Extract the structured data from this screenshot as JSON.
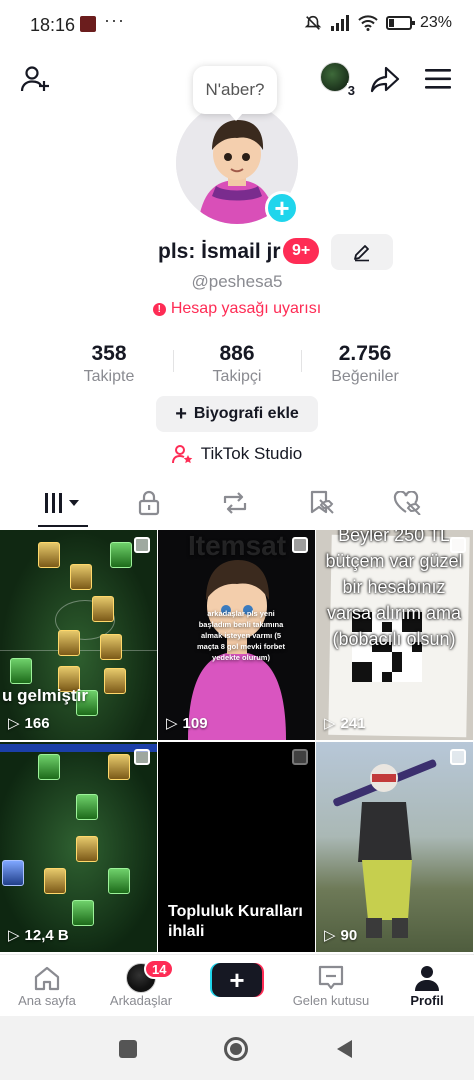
{
  "status_bar": {
    "time": "18:16",
    "dots": "···",
    "battery": "23%"
  },
  "header": {
    "friends_count": "3"
  },
  "tooltip": "N'aber?",
  "profile": {
    "username": "pls: İsmail jr",
    "badge": "9+",
    "handle": "@peshesa5",
    "warning": "Hesap yasağı uyarısı"
  },
  "stats": [
    {
      "value": "358",
      "label": "Takipte"
    },
    {
      "value": "886",
      "label": "Takipçi"
    },
    {
      "value": "2.756",
      "label": "Beğeniler"
    }
  ],
  "bio_button": "Biyografi ekle",
  "studio_link": "TikTok Studio",
  "tabs": [
    "videos-tab",
    "private-tab",
    "reposts-tab",
    "favorites-tab",
    "liked-tab"
  ],
  "videos": [
    {
      "views": "166",
      "overlay": "u gelmiştir"
    },
    {
      "views": "109",
      "overlay": "arkadaşlar pls yeni başladım benli takımına almak isteyen varmı (5 maçta 8 gol mevki forbet yedekte olurum)",
      "watermark": "Itemsat"
    },
    {
      "views": "241",
      "overlay": "Beyler 250 TL bütçem var güzel bir hesabınız varsa alırım ama (bobacılı olsun)"
    },
    {
      "views": "12,4 B",
      "overlay": ""
    },
    {
      "views": "",
      "overlay": "Topluluk Kuralları ihlali"
    },
    {
      "views": "90",
      "overlay": ""
    }
  ],
  "bottom_nav": [
    {
      "label": "Ana sayfa"
    },
    {
      "label": "Arkadaşlar",
      "badge": "14"
    },
    {
      "label": ""
    },
    {
      "label": "Gelen kutusu"
    },
    {
      "label": "Profil"
    }
  ],
  "colors": {
    "accent": "#fe2c55",
    "cyan": "#20d5ec",
    "text": "#161823",
    "muted": "#8a8b91"
  }
}
